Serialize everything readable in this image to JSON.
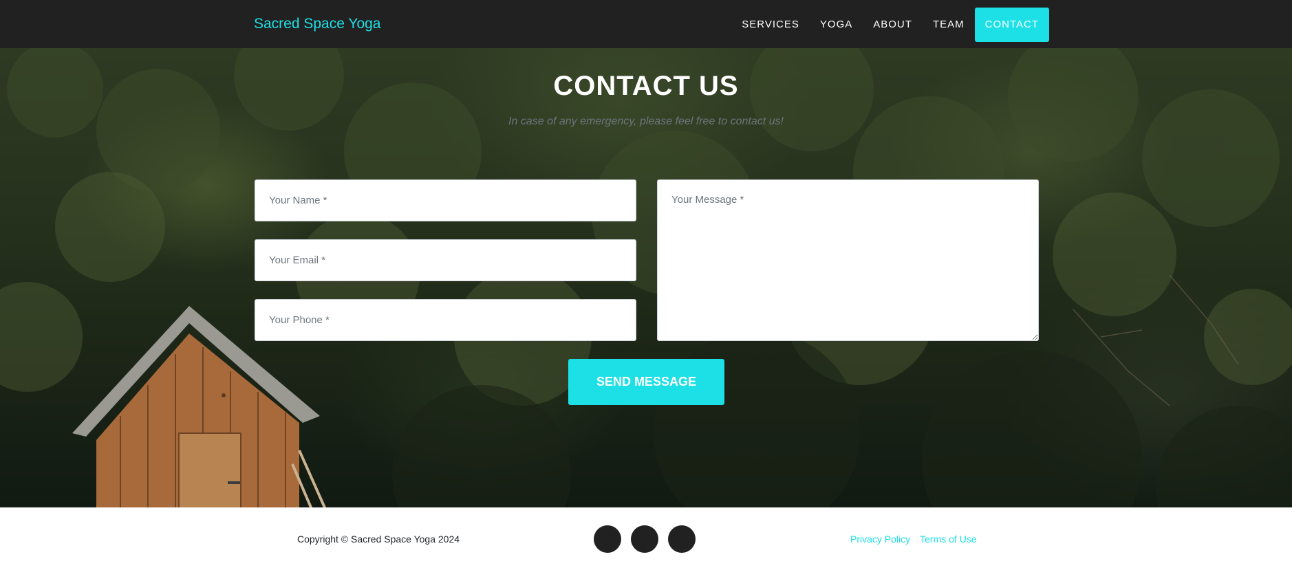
{
  "colors": {
    "accent": "#1de0e6",
    "navbar_bg": "#212121",
    "footer_bg": "#ffffff"
  },
  "navbar": {
    "brand": "Sacred Space Yoga",
    "links": [
      {
        "label": "SERVICES",
        "active": false
      },
      {
        "label": "YOGA",
        "active": false
      },
      {
        "label": "ABOUT",
        "active": false
      },
      {
        "label": "TEAM",
        "active": false
      },
      {
        "label": "CONTACT",
        "active": true
      }
    ]
  },
  "contact": {
    "title": "CONTACT US",
    "subtitle": "In case of any emergency, please feel free to contact us!",
    "form": {
      "name_placeholder": "Your Name *",
      "email_placeholder": "Your Email *",
      "phone_placeholder": "Your Phone *",
      "message_placeholder": "Your Message *",
      "submit_label": "SEND MESSAGE"
    }
  },
  "footer": {
    "copyright": "Copyright © Sacred Space Yoga 2024",
    "social": [
      {
        "icon": "twitter-icon"
      },
      {
        "icon": "facebook-icon"
      },
      {
        "icon": "linkedin-icon"
      }
    ],
    "links": [
      {
        "label": "Privacy Policy"
      },
      {
        "label": "Terms of Use"
      }
    ]
  }
}
